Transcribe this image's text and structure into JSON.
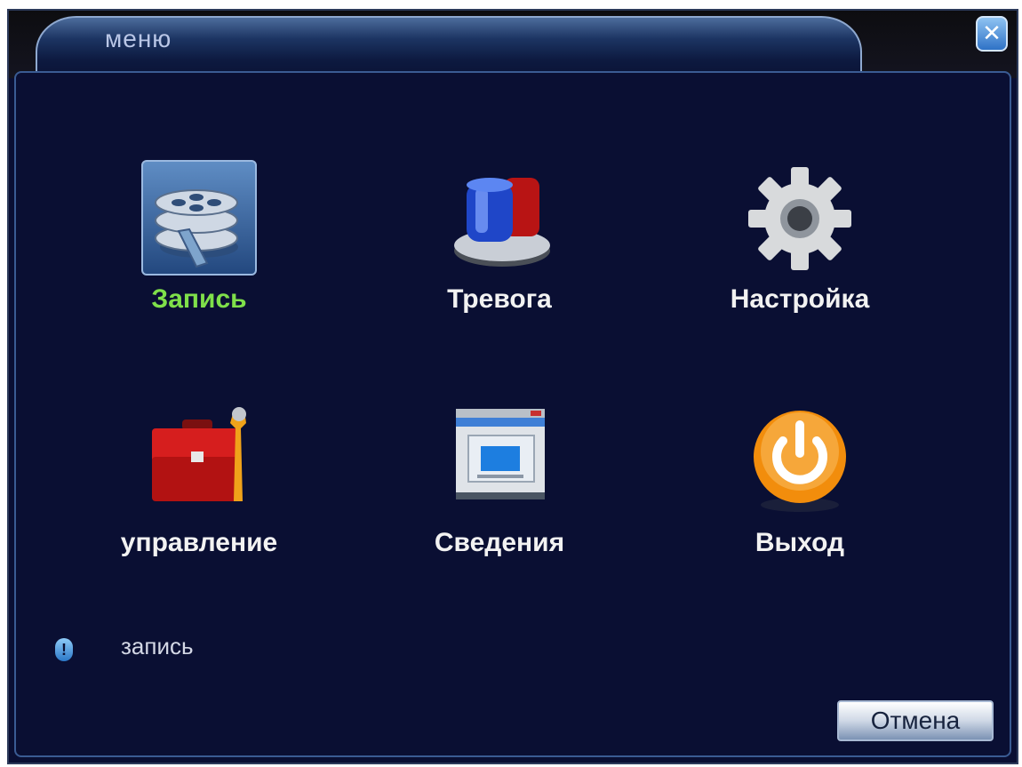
{
  "window": {
    "title": "меню",
    "close_icon": "close-icon"
  },
  "menu": {
    "items": [
      {
        "label": "Запись",
        "icon": "film-reels-icon",
        "selected": true
      },
      {
        "label": "Тревога",
        "icon": "alarm-siren-icon",
        "selected": false
      },
      {
        "label": "Настройка",
        "icon": "gear-icon",
        "selected": false
      },
      {
        "label": "управление",
        "icon": "toolbox-icon",
        "selected": false
      },
      {
        "label": "Сведения",
        "icon": "info-window-icon",
        "selected": false
      },
      {
        "label": "Выход",
        "icon": "power-icon",
        "selected": false
      }
    ]
  },
  "hint": {
    "text": "запись",
    "icon": "info-icon"
  },
  "footer": {
    "cancel_label": "Отмена"
  },
  "colors": {
    "selected_label": "#7fe04a",
    "background": "#0a0f33"
  }
}
